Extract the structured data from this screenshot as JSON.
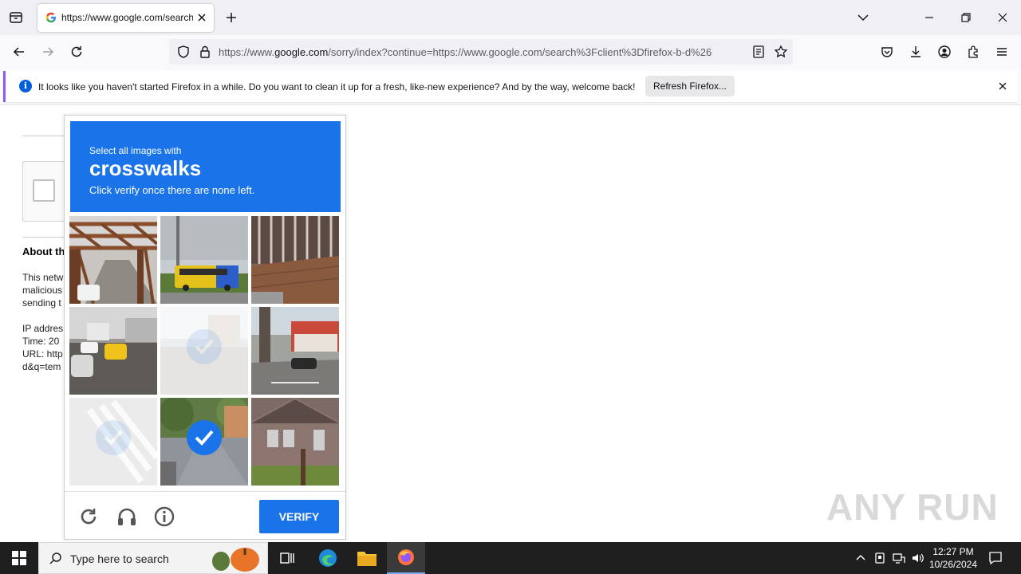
{
  "browser": {
    "tab_title": "https://www.google.com/search",
    "url_domain": "google.com",
    "url_prefix": "https://www.",
    "url_rest": "/sorry/index?continue=https://www.google.com/search%3Fclient%3Dfirefox-b-d%26",
    "notification": {
      "message": "It looks like you haven't started Firefox in a while. Do you want to clean it up for a fresh, like-new experience? And by the way, welcome back!",
      "button": "Refresh Firefox..."
    }
  },
  "page": {
    "about_title": "About th",
    "lines_block1": [
      "This netw",
      "malicious",
      "sending t"
    ],
    "lines_block2": [
      "IP addres",
      "Time: 20",
      "URL: http",
      "d&q=tem"
    ]
  },
  "captcha": {
    "instruction_small": "Select all images with",
    "target": "crosswalks",
    "instruction_sub": "Click verify once there are none left.",
    "verify_label": "VERIFY",
    "tiles": [
      {
        "name": "bridge",
        "state": "none"
      },
      {
        "name": "bus",
        "state": "none"
      },
      {
        "name": "building-wall",
        "state": "none"
      },
      {
        "name": "street-cars",
        "state": "none"
      },
      {
        "name": "faded-tile",
        "state": "fading"
      },
      {
        "name": "street-corner",
        "state": "none"
      },
      {
        "name": "crosswalk-faded",
        "state": "fading"
      },
      {
        "name": "street-trees",
        "state": "selected"
      },
      {
        "name": "house",
        "state": "none"
      }
    ]
  },
  "watermark": "ANY RUN",
  "taskbar": {
    "search_placeholder": "Type here to search",
    "time": "12:27 PM",
    "date": "10/26/2024"
  },
  "colors": {
    "captcha_blue": "#1a73e8",
    "notice_accent": "#8a5cf5",
    "taskbar": "#1f1f1f"
  }
}
